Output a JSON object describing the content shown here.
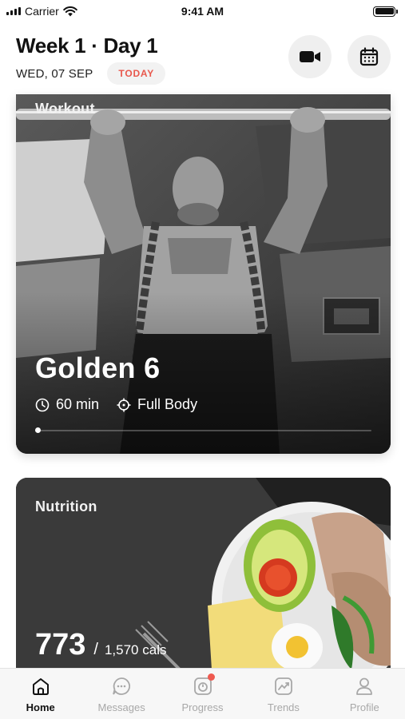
{
  "status_bar": {
    "carrier": "Carrier",
    "time": "9:41 AM",
    "icons": [
      "signal-icon",
      "wifi-icon",
      "battery-icon"
    ]
  },
  "header": {
    "title": "Week 1 · Day 1",
    "date": "WED, 07 SEP",
    "badge": "TODAY",
    "badge_color": "#e8584d",
    "buttons": [
      "video-camera-icon",
      "calendar-icon"
    ]
  },
  "workout": {
    "label": "Workout",
    "name": "Golden 6",
    "duration": "60 min",
    "focus": "Full Body",
    "progress": 0
  },
  "nutrition": {
    "label": "Nutrition",
    "calories": "773",
    "separator": "/",
    "calories_total": "1,570 cals"
  },
  "tabs": [
    {
      "label": "Home",
      "icon": "home-icon",
      "active": true
    },
    {
      "label": "Messages",
      "icon": "chat-bubble-icon",
      "active": false
    },
    {
      "label": "Progress",
      "icon": "scale-icon",
      "active": false,
      "badge": true
    },
    {
      "label": "Trends",
      "icon": "trend-chart-icon",
      "active": false
    },
    {
      "label": "Profile",
      "icon": "user-icon",
      "active": false
    }
  ],
  "colors": {
    "accent": "#e8584d",
    "tab_active": "#111111",
    "tab_inactive": "#a8a8a8",
    "button_bg": "#efefef"
  }
}
